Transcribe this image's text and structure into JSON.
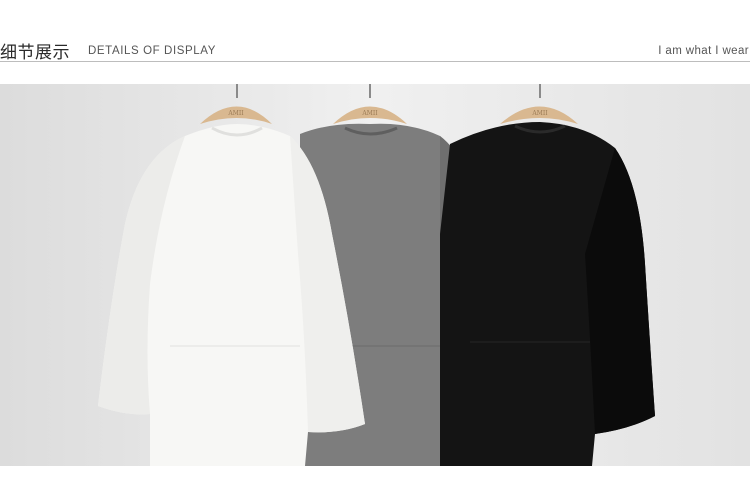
{
  "header": {
    "title_cn": "细节展示",
    "title_en": "DETAILS OF DISPLAY",
    "tagline": "I am what I wear"
  },
  "photo": {
    "garments": [
      {
        "color_name": "white",
        "fill": "#f6f6f4",
        "hanger_text": "AMII"
      },
      {
        "color_name": "grey",
        "fill": "#7c7c7c",
        "hanger_text": "AMII"
      },
      {
        "color_name": "black",
        "fill": "#121212",
        "hanger_text": "AMII"
      }
    ]
  },
  "colors": {
    "wall": "#e9e9e9",
    "hanger": "#d9b890",
    "rule": "#bdbdbd"
  }
}
